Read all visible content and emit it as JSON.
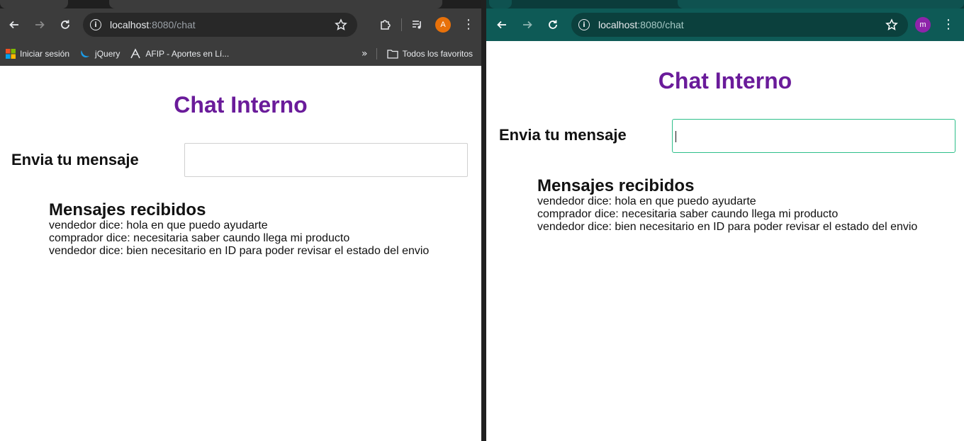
{
  "windows": {
    "left": {
      "url_host": "localhost",
      "url_rest": ":8080/chat",
      "profile_initial": "A",
      "bookmarks": [
        {
          "label": "Iniciar sesión",
          "icon": "microsoft-icon"
        },
        {
          "label": "jQuery",
          "icon": "jquery-icon"
        },
        {
          "label": "AFIP - Aportes en Lí...",
          "icon": "afip-icon"
        }
      ],
      "all_bookmarks_label": "Todos los favoritos"
    },
    "right": {
      "url_host": "localhost",
      "url_rest": ":8080/chat",
      "profile_initial": "m"
    }
  },
  "chat": {
    "title": "Chat Interno",
    "send_label": "Envia tu mensaje",
    "input_value": "",
    "received_heading": "Mensajes recibidos",
    "messages": [
      "vendedor dice: hola en que puedo ayudarte",
      "comprador dice: necesitaria saber caundo llega mi producto",
      "vendedor dice: bien necesitario en ID para poder revisar el estado del envio"
    ]
  },
  "colors": {
    "title": "#6a1b9a",
    "left_chrome": "#3c3c3c",
    "right_chrome": "#0e5a56",
    "focus_border": "#2ebf8a"
  }
}
